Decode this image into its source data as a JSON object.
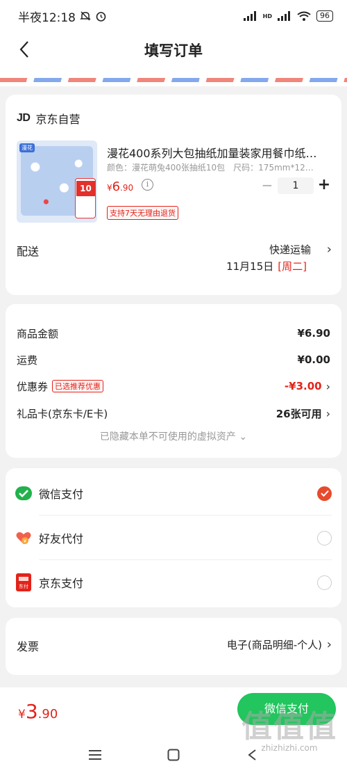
{
  "status_bar": {
    "time": "半夜12:18",
    "network": "HD",
    "battery": "96"
  },
  "nav": {
    "title": "填写订单"
  },
  "shop": {
    "name": "京东自营"
  },
  "product": {
    "title": "漫花400系列大包抽纸加量装家用餐巾纸…",
    "spec": "颜色：漫花萌兔400张抽纸10包　尺码：175mm*12…",
    "price_symbol": "¥",
    "price_int": "6",
    "price_dec": ".90",
    "quantity": "1",
    "return_badge": "支持7天无理由退货",
    "image_flag": "漫花",
    "image_count": "10包"
  },
  "shipping": {
    "label": "配送",
    "method": "快递运输",
    "date": "11月15日",
    "weekday": "[周二]"
  },
  "price_summary": {
    "rows": [
      {
        "label": "商品金额",
        "value": "¥6.90"
      },
      {
        "label": "运费",
        "value": "¥0.00"
      },
      {
        "label": "优惠券",
        "badge": "已选推荐优惠",
        "value": "-¥3.00"
      },
      {
        "label": "礼品卡(京东卡/E卡)",
        "value": "26张可用"
      }
    ],
    "hidden_note": "已隐藏本单不可使用的虚拟资产 ⌄"
  },
  "payment_methods": [
    {
      "label": "微信支付",
      "icon": "wechat-pay-icon",
      "selected": true
    },
    {
      "label": "好友代付",
      "icon": "friend-pay-icon",
      "selected": false
    },
    {
      "label": "京东支付",
      "icon": "jd-pay-icon",
      "selected": false
    }
  ],
  "invoice": {
    "label": "发票",
    "value": "电子(商品明细-个人)"
  },
  "bottom": {
    "total_symbol": "¥",
    "total_int": "3",
    "total_dec": ".90",
    "pay_button": "微信支付"
  },
  "watermark": {
    "chars": "值值值",
    "url": "zhizhizhi.com"
  },
  "colors": {
    "accent_red": "#e2231a",
    "wechat_green": "#22c55e",
    "check_orange": "#e64b2e"
  }
}
